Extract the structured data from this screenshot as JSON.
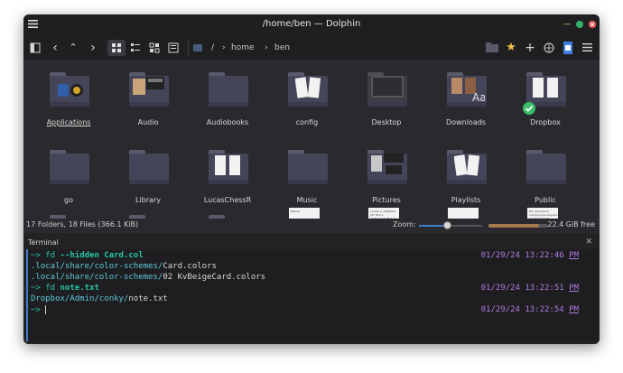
{
  "window": {
    "title": "/home/ben — Dolphin"
  },
  "breadcrumb": {
    "sep": "/",
    "home": "home",
    "ben": "ben"
  },
  "grid": [
    {
      "label": "Applications",
      "type": "apps"
    },
    {
      "label": "Audio",
      "type": "photos"
    },
    {
      "label": "Audiobooks",
      "type": "plain"
    },
    {
      "label": "config",
      "type": "docs"
    },
    {
      "label": "Desktop",
      "type": "desktop"
    },
    {
      "label": "Downloads",
      "type": "downloads"
    },
    {
      "label": "Dropbox",
      "type": "dropbox"
    },
    {
      "label": "go",
      "type": "plain"
    },
    {
      "label": "Library",
      "type": "plain"
    },
    {
      "label": "LucasChessR",
      "type": "docs"
    },
    {
      "label": "Music",
      "type": "plain"
    },
    {
      "label": "Pictures",
      "type": "photos"
    },
    {
      "label": "Playlists",
      "type": "docs"
    },
    {
      "label": "Public",
      "type": "plain"
    }
  ],
  "partial_docs": [
    {
      "text": "Bishop"
    },
    {
      "text": "scripts.rc.GEBUILD gfx fit.2.1 settings.lua fit.2.1 overview.2.1 more"
    },
    {
      "text": ""
    },
    {
      "text": "Pen dimension summary/workspace monitor/results Comparison/frame"
    }
  ],
  "status": {
    "summary": "17 Folders, 18 Files (366.1 KiB)",
    "zoom_label": "Zoom:",
    "free": "22.4 GiB free",
    "zoom_level": 0.45,
    "used_fraction": 0.85
  },
  "terminal": {
    "title": "Terminal",
    "lines": [
      {
        "prompt": "~> ",
        "cmd": "fd ",
        "arg": "--hidden Card.col",
        "ts": "01/29/24 13:22:46 ",
        "pm": "PM"
      },
      {
        "path": ".local/share/color-schemes/",
        "file": "Card.colors"
      },
      {
        "path": ".local/share/color-schemes/",
        "file": "02 KvBeigeCard.colors"
      },
      {
        "prompt": "~> ",
        "cmd": "fd ",
        "arg": "note.txt",
        "ts": "01/29/24 13:22:51 ",
        "pm": "PM"
      },
      {
        "path": "Dropbox/Admin/conky/",
        "file": "note.txt"
      },
      {
        "prompt": "~> ",
        "cmd": "",
        "arg": "",
        "ts": "01/29/24 13:22:54 ",
        "pm": "PM"
      }
    ]
  },
  "colors": {
    "prompt": "#26c6a6",
    "path": "#5ec8d8",
    "accent": "#3b7dc8",
    "timestamp": "#b07be0"
  }
}
